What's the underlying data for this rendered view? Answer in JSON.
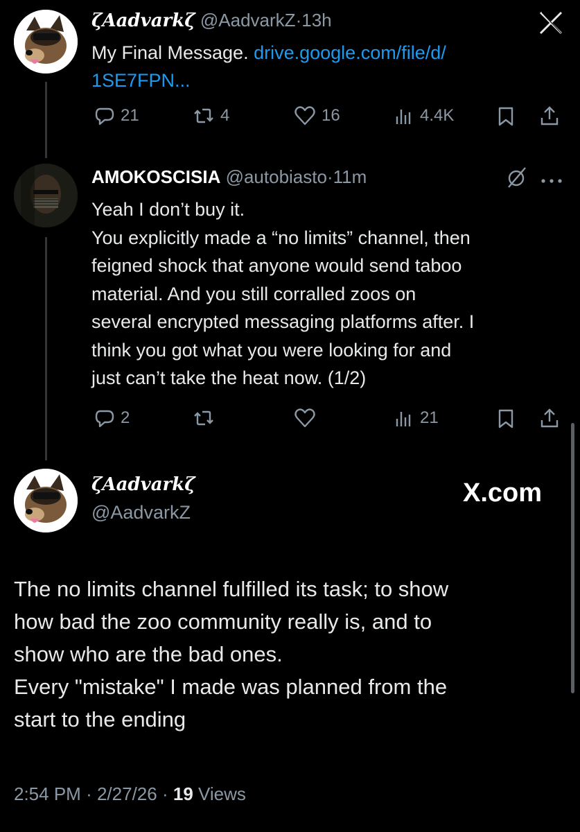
{
  "colors": {
    "background": "#000000",
    "text": "#e7e9ea",
    "secondary": "#8b98a5",
    "link": "#1d9bf0"
  },
  "tweet1": {
    "display_name": "ζAadvarkζ",
    "handle": "@AadvarkZ",
    "separator": "·",
    "time": "13h",
    "text": "My Final Message.",
    "link_line1": "drive.google.com/file/d/",
    "link_line2": "1SE7FPN...",
    "replies": "21",
    "reposts": "4",
    "likes": "16",
    "views": "4.4K"
  },
  "tweet2": {
    "display_name": "AMOKOSCISIA",
    "handle": "@autobiasto",
    "separator": "·",
    "time": "11m",
    "lines": [
      "Yeah I don’t buy it.",
      "You explicitly made a “no limits” channel, then",
      "feigned shock that anyone would send taboo",
      "material. And you still corralled zoos on",
      "several encrypted messaging platforms after. I",
      "think you got what you were looking for and",
      "just can’t take the heat now. (1/2)"
    ],
    "replies": "2",
    "views": "21"
  },
  "main_post": {
    "display_name": "ζAadvarkζ",
    "handle": "@AadvarkZ",
    "brand": "X.com",
    "lines": [
      "The no limits channel fulfilled its task; to show",
      "how bad the zoo community really is, and to",
      "show who are the bad ones.",
      "Every \"mistake\" I made was planned from the",
      "start to the ending"
    ],
    "time": "2:54 PM",
    "date": "2/27/26",
    "views_count": "19",
    "views_label": "Views"
  },
  "icons": [
    "close-x-icon",
    "reply-icon",
    "repost-icon",
    "like-icon",
    "views-icon",
    "bookmark-icon",
    "share-icon",
    "grok-icon",
    "more-icon"
  ]
}
